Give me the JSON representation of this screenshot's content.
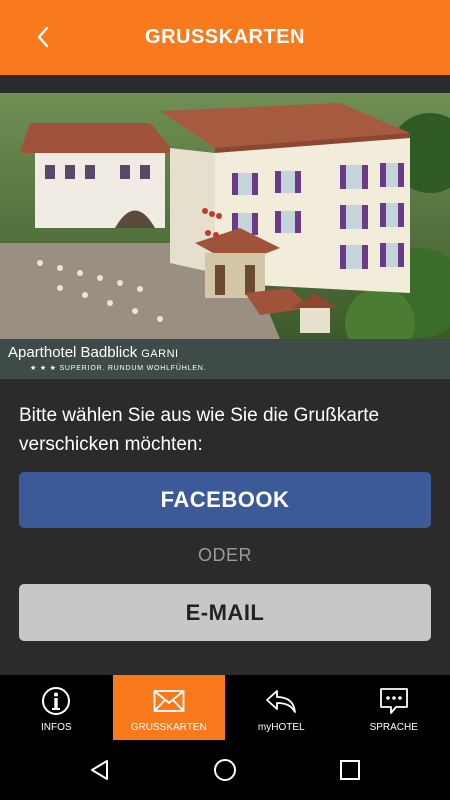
{
  "header": {
    "title": "GRUSSKARTEN",
    "background_color": "#f87a1d",
    "back_icon": "chevron-left-icon"
  },
  "hero": {
    "hotel_name": "Aparthotel Badblick",
    "hotel_suffix": "GARNI",
    "tagline": "★ ★ ★  SUPERIOR. RUNDUM WOHLFÜHLEN."
  },
  "main": {
    "instruction": "Bitte wählen Sie aus wie Sie die Grußkarte verschicken möchten:",
    "facebook_label": "FACEBOOK",
    "facebook_color": "#3d5a98",
    "separator": "ODER",
    "email_label": "E-MAIL",
    "email_color": "#c7c7c7"
  },
  "bottom_nav": {
    "items": [
      {
        "label": "INFOS",
        "icon": "info-icon",
        "active": false
      },
      {
        "label": "GRUSSKARTEN",
        "icon": "envelope-icon",
        "active": true
      },
      {
        "label": "myHOTEL",
        "icon": "reply-arrow-icon",
        "active": false
      },
      {
        "label": "SPRACHE",
        "icon": "chat-bubble-icon",
        "active": false
      }
    ]
  },
  "system_nav": {
    "back_icon": "triangle-back-icon",
    "home_icon": "circle-home-icon",
    "recents_icon": "square-recents-icon"
  }
}
